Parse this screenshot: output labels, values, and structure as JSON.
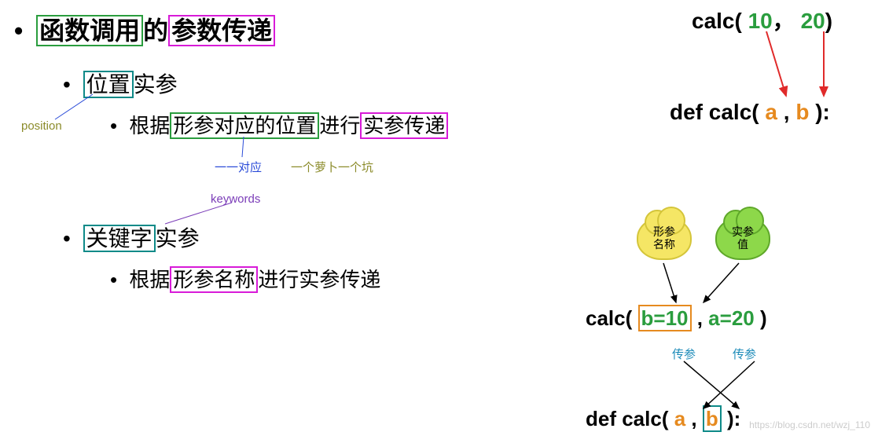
{
  "title": {
    "part1": "函数调用",
    "mid": "的",
    "part2": "参数传递"
  },
  "section1": {
    "label_boxed": "位置",
    "label_rest": "实参",
    "desc_pre": "根据",
    "desc_box1": "形参对应的位置",
    "desc_mid": "进行",
    "desc_box2": "实参传递"
  },
  "section2": {
    "label_boxed": "关键字",
    "label_rest": "实参",
    "desc_pre": "根据",
    "desc_box1": "形参名称",
    "desc_rest": "进行实参传递"
  },
  "annotations": {
    "position": "position",
    "keywords": "keywords",
    "map": "一一对应",
    "radish": "一个萝卜一个坑"
  },
  "diagram1": {
    "call_fn": "calc(",
    "arg1": "10",
    "sep": "，",
    "arg2": "20",
    "close": ")",
    "def_pre": "def calc(",
    "param1": "a",
    "param_sep": " , ",
    "param2": "b",
    "def_close": " ):"
  },
  "diagram2": {
    "cloud1": "形参\n名称",
    "cloud2": "实参\n值",
    "call_fn": "calc(",
    "kw1": "b=10",
    "sep": " , ",
    "kw2": "a=20",
    "close": "   )",
    "pass_label": "传参",
    "def_pre": "def calc(",
    "param1": "a",
    "param_sep": " , ",
    "param2": "b",
    "def_close": " ):"
  },
  "watermark": "https://blog.csdn.net/wzj_110"
}
